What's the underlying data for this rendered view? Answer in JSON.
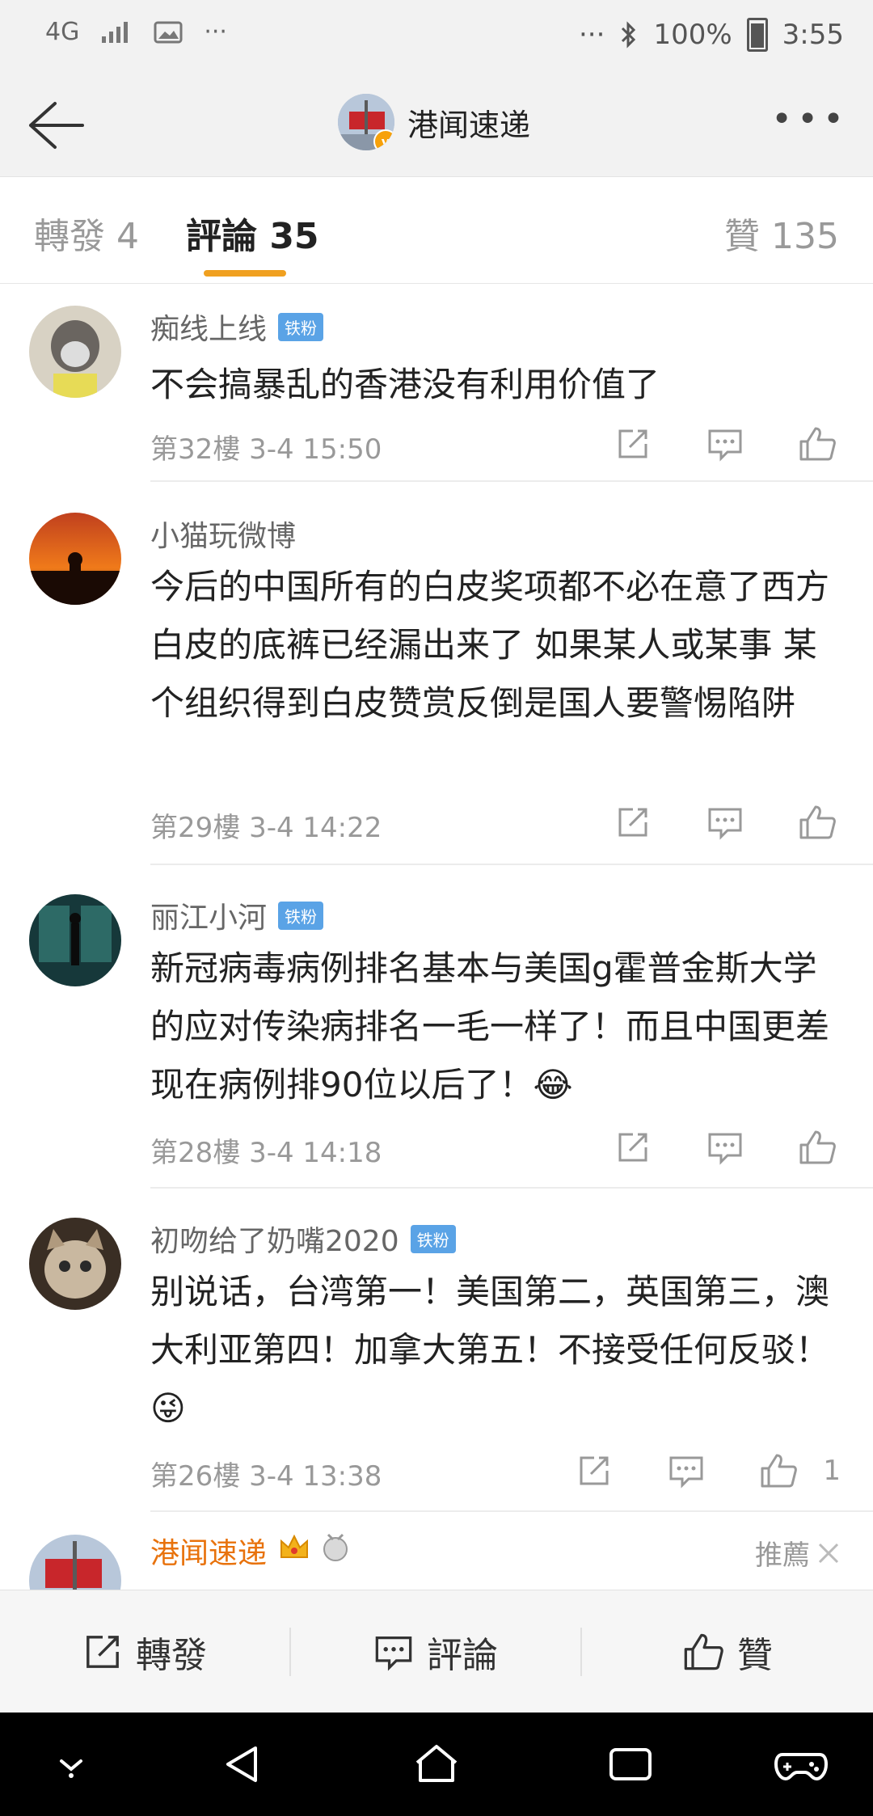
{
  "status_bar": {
    "network": "4G",
    "dots_left": "···",
    "dots_right": "···",
    "battery": "100%",
    "time": "3:55"
  },
  "header": {
    "title": "港闻速递",
    "verified_mark": "v"
  },
  "tabs": [
    {
      "label": "轉發 4"
    },
    {
      "label": "評論 35"
    },
    {
      "label": "贊 135"
    }
  ],
  "comments": [
    {
      "name": "痴线上线",
      "badge": "铁粉",
      "text": "不会搞暴乱的香港没有利用价值了",
      "meta": "第32樓 3-4 15:50",
      "likes": ""
    },
    {
      "name": "小猫玩微博",
      "badge": "",
      "text": "今后的中国所有的白皮奖项都不必在意了西方白皮的底裤已经漏出来了 如果某人或某事 某个组织得到白皮赞赏反倒是国人要警惕陷阱",
      "meta": "第29樓 3-4 14:22",
      "likes": ""
    },
    {
      "name": "丽江小河",
      "badge": "铁粉",
      "text": "新冠病毒病例排名基本与美国g霍普金斯大学的应对传染病排名一毛一样了！而且中国更差现在病例排90位以后了！😂",
      "meta": "第28樓 3-4 14:18",
      "likes": ""
    },
    {
      "name": "初吻给了奶嘴2020",
      "badge": "铁粉",
      "text": "别说话，台湾第一！美国第二，英国第三，澳大利亚第四！加拿大第五！不接受任何反驳！😜",
      "meta": "第26樓 3-4 13:38",
      "likes": "1"
    }
  ],
  "partial_comment": {
    "name": "港闻速递",
    "recommend": "推薦"
  },
  "bottom_bar": {
    "repost": "轉發",
    "comment": "評論",
    "like": "贊"
  },
  "colors": {
    "accent": "#f0a020",
    "badge": "#5aa3e6",
    "orange_name": "#e8720c"
  }
}
